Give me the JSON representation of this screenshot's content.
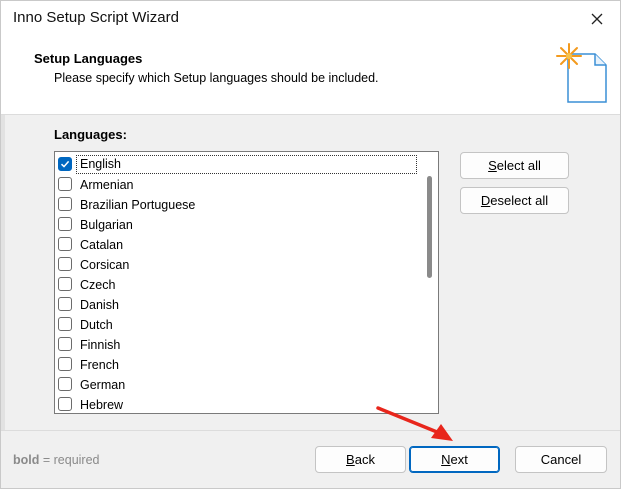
{
  "window": {
    "title": "Inno Setup Script Wizard"
  },
  "header": {
    "title": "Setup Languages",
    "subtitle": "Please specify which Setup languages should be included."
  },
  "languages": {
    "label": "Languages:",
    "items": [
      {
        "label": "English",
        "checked": true
      },
      {
        "label": "Armenian",
        "checked": false
      },
      {
        "label": "Brazilian Portuguese",
        "checked": false
      },
      {
        "label": "Bulgarian",
        "checked": false
      },
      {
        "label": "Catalan",
        "checked": false
      },
      {
        "label": "Corsican",
        "checked": false
      },
      {
        "label": "Czech",
        "checked": false
      },
      {
        "label": "Danish",
        "checked": false
      },
      {
        "label": "Dutch",
        "checked": false
      },
      {
        "label": "Finnish",
        "checked": false
      },
      {
        "label": "French",
        "checked": false
      },
      {
        "label": "German",
        "checked": false
      },
      {
        "label": "Hebrew",
        "checked": false
      }
    ]
  },
  "buttons": {
    "select_all_key": "S",
    "select_all_rest": "elect all",
    "deselect_all_key": "D",
    "deselect_all_rest": "eselect all",
    "back_key": "B",
    "back_rest": "ack",
    "next_key": "N",
    "next_rest": "ext",
    "cancel": "Cancel"
  },
  "footer": {
    "bold_word": "bold",
    "note_rest": " = required"
  },
  "colors": {
    "accent": "#0067c0",
    "arrow": "#e8261c"
  }
}
